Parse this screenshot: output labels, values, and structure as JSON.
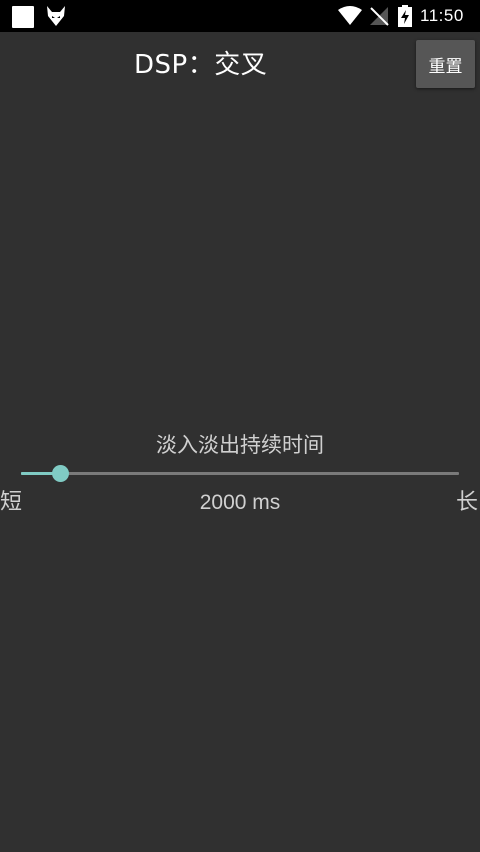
{
  "status_bar": {
    "time": "11:50",
    "icons": [
      "notification-square-icon",
      "fox-app-icon",
      "wifi-icon",
      "signal-off-icon",
      "battery-charging-icon"
    ]
  },
  "header": {
    "title": "DSP：交叉",
    "reset_label": "重置"
  },
  "fade_slider": {
    "label": "淡入淡出持续时间",
    "min_label": "短",
    "max_label": "长",
    "value_text": "2000 ms",
    "position_fraction": 0.09,
    "accent_color": "#80cbc4"
  },
  "colors": {
    "background": "#303030",
    "status_bar": "#000000",
    "button": "#565656"
  }
}
